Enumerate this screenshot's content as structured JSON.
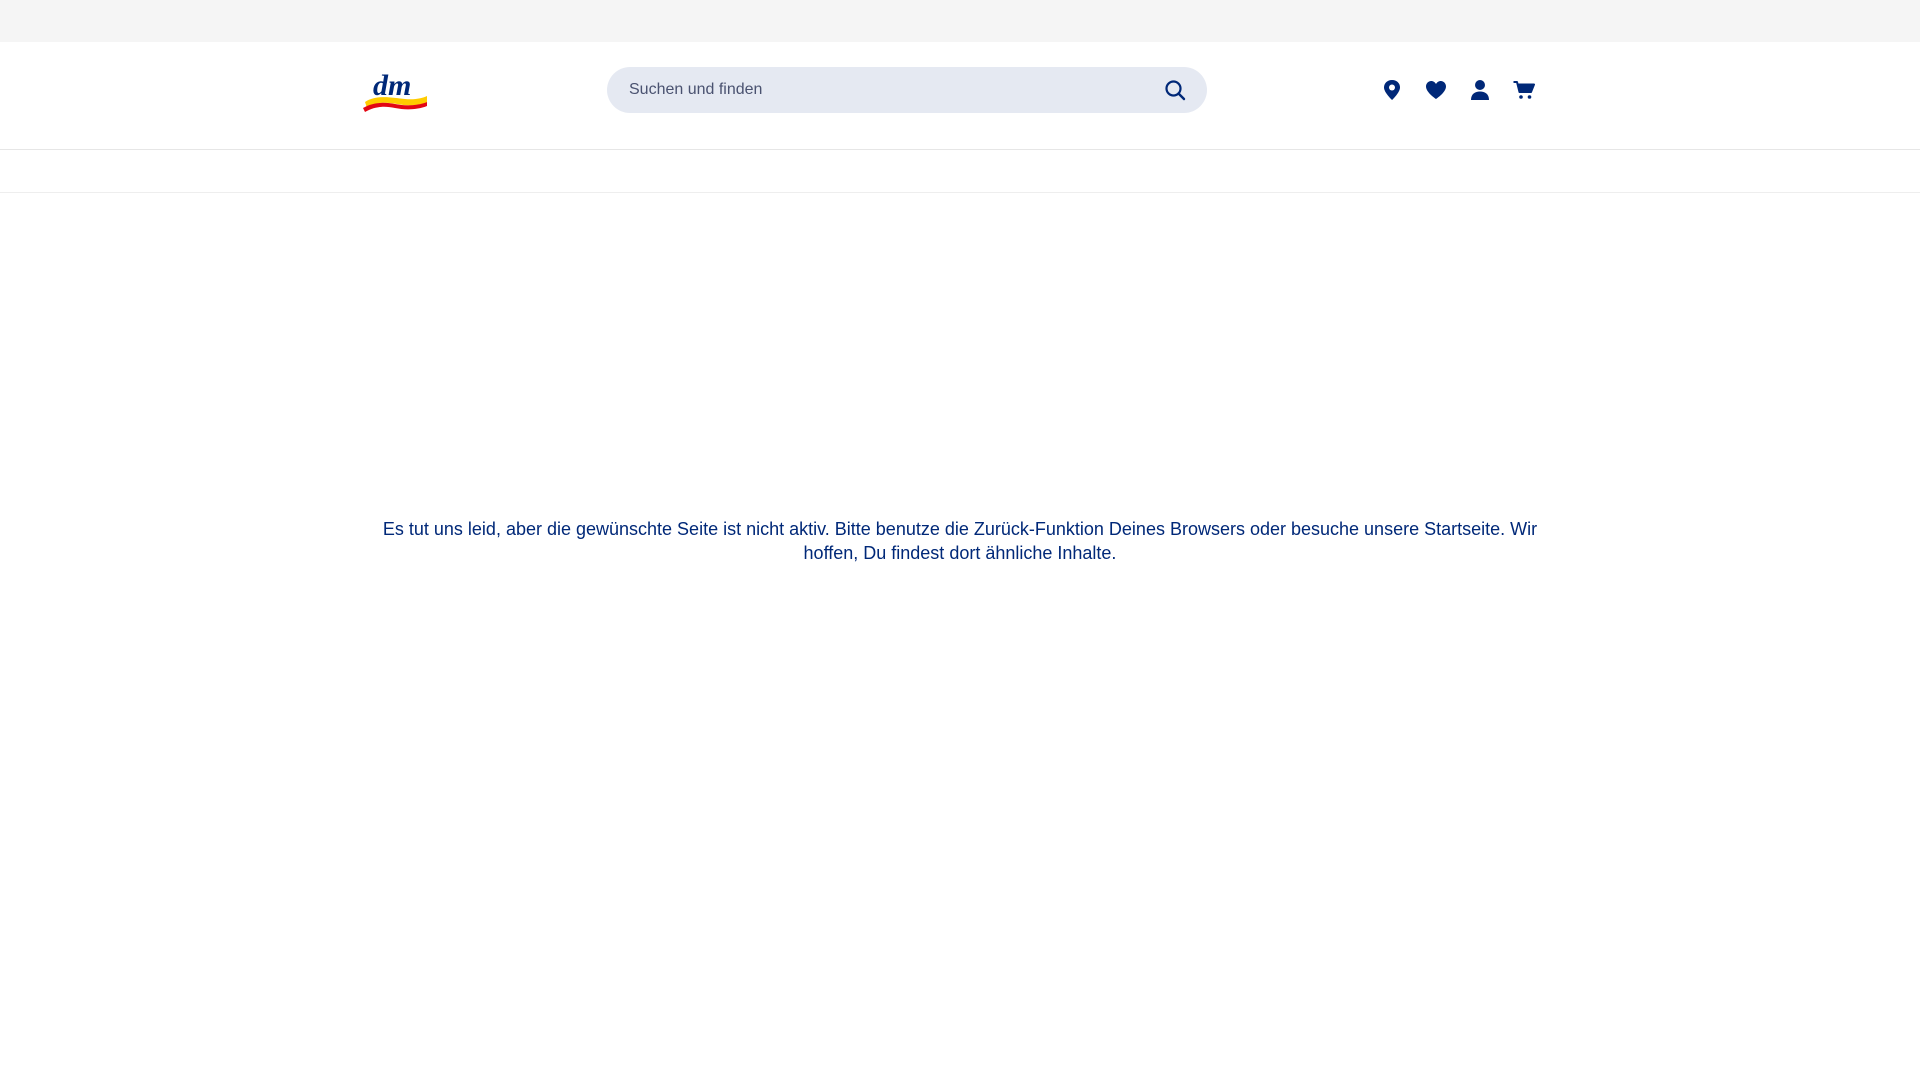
{
  "header": {
    "logo_name": "dm",
    "search": {
      "placeholder": "Suchen und finden",
      "value": ""
    },
    "icons": [
      {
        "name": "location-pin-icon"
      },
      {
        "name": "heart-icon"
      },
      {
        "name": "user-icon"
      },
      {
        "name": "cart-icon"
      }
    ]
  },
  "main": {
    "error_message": "Es tut uns leid, aber die gewünschte Seite ist nicht aktiv. Bitte benutze die Zurück-Funktion Deines Browsers oder besuche unsere Startseite. Wir hoffen, Du findest dort ähnliche Inhalte."
  },
  "colors": {
    "primary": "#002878",
    "search_bg": "#e5e9f2",
    "top_strip": "#f5f5f5",
    "logo_yellow": "#ffcc00",
    "logo_red": "#e30613"
  }
}
